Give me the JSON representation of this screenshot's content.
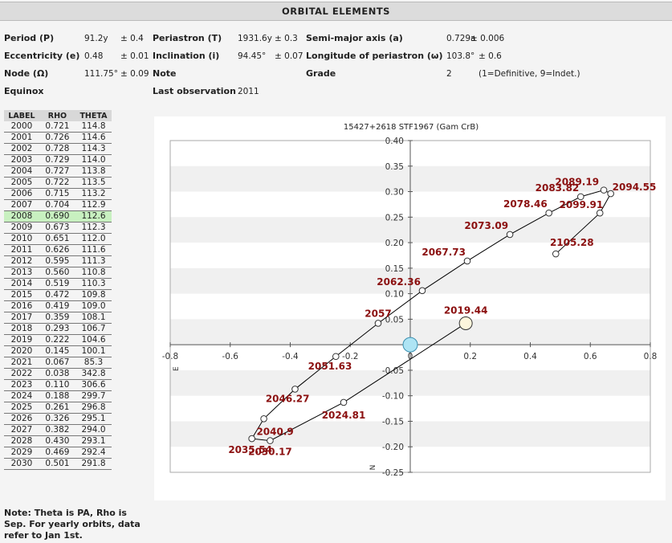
{
  "header": {
    "title": "ORBITAL ELEMENTS"
  },
  "params": {
    "row1": [
      {
        "label": "Period (P)",
        "value": "91.2y",
        "err": "± 0.4"
      },
      {
        "label": "Periastron (T)",
        "value": "1931.6y",
        "err": "± 0.3"
      },
      {
        "label": "Semi-major axis (a)",
        "value": "0.729a",
        "err": "± 0.006"
      }
    ],
    "row2": [
      {
        "label": "Eccentricity (e)",
        "value": "0.48",
        "err": "± 0.01"
      },
      {
        "label": "Inclination (i)",
        "value": "94.45°",
        "err": "± 0.07"
      },
      {
        "label": "Longitude of periastron (ω)",
        "value": "103.8°",
        "err": "± 0.6"
      }
    ],
    "row3": [
      {
        "label": "Node (Ω)",
        "value": "111.75°",
        "err": "± 0.09"
      },
      {
        "label": "Note",
        "value": ""
      },
      {
        "label": "Grade",
        "value": "2",
        "extra": "(1=Definitive, 9=Indet.)"
      }
    ],
    "row4": [
      {
        "label": "Equinox",
        "value": ""
      },
      {
        "label": "Last observation",
        "value": "2011"
      }
    ]
  },
  "table": {
    "headers": [
      "LABEL",
      "RHO",
      "THETA"
    ],
    "highlight_label": "2008",
    "rows": [
      [
        "2000",
        "0.721",
        "114.8"
      ],
      [
        "2001",
        "0.726",
        "114.6"
      ],
      [
        "2002",
        "0.728",
        "114.3"
      ],
      [
        "2003",
        "0.729",
        "114.0"
      ],
      [
        "2004",
        "0.727",
        "113.8"
      ],
      [
        "2005",
        "0.722",
        "113.5"
      ],
      [
        "2006",
        "0.715",
        "113.2"
      ],
      [
        "2007",
        "0.704",
        "112.9"
      ],
      [
        "2008",
        "0.690",
        "112.6"
      ],
      [
        "2009",
        "0.673",
        "112.3"
      ],
      [
        "2010",
        "0.651",
        "112.0"
      ],
      [
        "2011",
        "0.626",
        "111.6"
      ],
      [
        "2012",
        "0.595",
        "111.3"
      ],
      [
        "2013",
        "0.560",
        "110.8"
      ],
      [
        "2014",
        "0.519",
        "110.3"
      ],
      [
        "2015",
        "0.472",
        "109.8"
      ],
      [
        "2016",
        "0.419",
        "109.0"
      ],
      [
        "2017",
        "0.359",
        "108.1"
      ],
      [
        "2018",
        "0.293",
        "106.7"
      ],
      [
        "2019",
        "0.222",
        "104.6"
      ],
      [
        "2020",
        "0.145",
        "100.1"
      ],
      [
        "2021",
        "0.067",
        "85.3"
      ],
      [
        "2022",
        "0.038",
        "342.8"
      ],
      [
        "2023",
        "0.110",
        "306.6"
      ],
      [
        "2024",
        "0.188",
        "299.7"
      ],
      [
        "2025",
        "0.261",
        "296.8"
      ],
      [
        "2026",
        "0.326",
        "295.1"
      ],
      [
        "2027",
        "0.382",
        "294.0"
      ],
      [
        "2028",
        "0.430",
        "293.1"
      ],
      [
        "2029",
        "0.469",
        "292.4"
      ],
      [
        "2030",
        "0.501",
        "291.8"
      ]
    ]
  },
  "note": "Note: Theta is PA, Rho is Sep. For yearly orbits, data refer to Jan 1st.",
  "chart_data": {
    "type": "scatter",
    "title": "15427+2618 STF1967 (Gam CrB)",
    "xlabel": "E",
    "ylabel": "N",
    "xlim": [
      -0.8,
      0.8
    ],
    "ylim": [
      -0.25,
      0.4
    ],
    "xticks": [
      "-0.8",
      "-0.6",
      "-0.4",
      "-0.2",
      "0",
      "0.2",
      "0.4",
      "0.6",
      "0.8"
    ],
    "yticks": [
      "0.40",
      "0.35",
      "0.30",
      "0.25",
      "0.20",
      "0.15",
      "0.10",
      "0.05",
      "0",
      "-0.05",
      "-0.10",
      "-0.15",
      "-0.20",
      "-0.25"
    ],
    "orbit_color": "#000000",
    "label_color": "#8b1010",
    "primary": {
      "x": 0.0,
      "y": 0.0,
      "color": "#aee4f4"
    },
    "current": {
      "label": "2019.44",
      "x": 0.185,
      "y": 0.042,
      "color": "#fdf6dc"
    },
    "points": [
      {
        "label": "2105.28",
        "x": 0.485,
        "y": 0.178
      },
      {
        "label": "2099.91",
        "x": 0.632,
        "y": 0.258
      },
      {
        "label": "2094.55",
        "x": 0.668,
        "y": 0.296
      },
      {
        "label": "2089.19",
        "x": 0.645,
        "y": 0.303
      },
      {
        "label": "2083.82",
        "x": 0.568,
        "y": 0.29
      },
      {
        "label": "2078.46",
        "x": 0.462,
        "y": 0.258
      },
      {
        "label": "2073.09",
        "x": 0.332,
        "y": 0.216
      },
      {
        "label": "2067.73",
        "x": 0.19,
        "y": 0.164
      },
      {
        "label": "2062.36",
        "x": 0.04,
        "y": 0.106
      },
      {
        "label": "2057",
        "x": -0.107,
        "y": 0.042
      },
      {
        "label": "2051.63",
        "x": -0.248,
        "y": -0.023
      },
      {
        "label": "2046.27",
        "x": -0.384,
        "y": -0.087
      },
      {
        "label": "2040.9",
        "x": -0.488,
        "y": -0.145
      },
      {
        "label": "2035.54",
        "x": -0.528,
        "y": -0.184
      },
      {
        "label": "2030.17",
        "x": -0.467,
        "y": -0.188
      },
      {
        "label": "2024.81",
        "x": -0.222,
        "y": -0.113
      }
    ]
  }
}
